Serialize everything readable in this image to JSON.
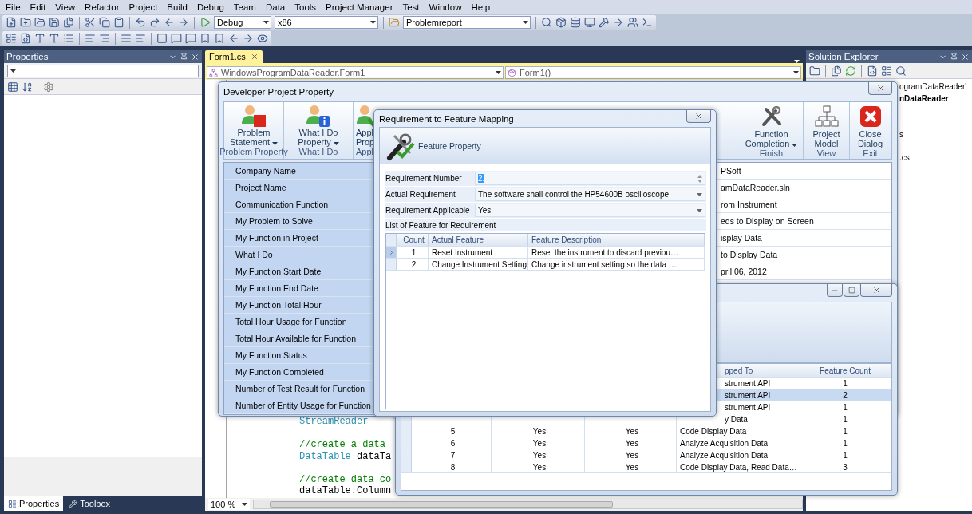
{
  "menu": [
    "File",
    "Edit",
    "View",
    "Refactor",
    "Project",
    "Build",
    "Debug",
    "Team",
    "Data",
    "Tools",
    "Project Manager",
    "Test",
    "Window",
    "Help"
  ],
  "toolbar": {
    "configuration": "Debug",
    "platform": "x86",
    "find_target": "Problemreport"
  },
  "properties_panel": {
    "title": "Properties",
    "tabs": [
      {
        "label": "Properties",
        "selected": true
      },
      {
        "label": "Toolbox",
        "selected": false
      }
    ]
  },
  "editor": {
    "tabs": [
      {
        "label": "Form1.cs",
        "selected": true
      }
    ],
    "class_selector": "WindowsProgramDataReader.Form1",
    "member_selector": "Form1()",
    "zoom": "100 %",
    "code_lines": [
      {
        "kind": "code",
        "tokens": [
          {
            "text": "StreamReader",
            "kind": "type"
          }
        ]
      },
      {
        "kind": "blank"
      },
      {
        "kind": "code",
        "tokens": [
          {
            "text": "//create a data",
            "kind": "comment"
          }
        ]
      },
      {
        "kind": "code",
        "tokens": [
          {
            "text": "DataTable",
            "kind": "type"
          },
          {
            "text": "dataTa",
            "kind": "code"
          }
        ]
      },
      {
        "kind": "blank"
      },
      {
        "kind": "code",
        "tokens": [
          {
            "text": "//create data co",
            "kind": "comment"
          }
        ]
      },
      {
        "kind": "code",
        "tokens": [
          {
            "text": "dataTable.Column",
            "kind": "code"
          }
        ]
      }
    ]
  },
  "solution_explorer": {
    "title": "Solution Explorer",
    "items": [
      {
        "label": "ogramDataReader'",
        "bold": false
      },
      {
        "label": "nDataReader",
        "bold": true
      },
      {
        "label": "s",
        "bold": false
      },
      {
        "label": ".cs",
        "bold": false
      }
    ]
  },
  "developer_window": {
    "title": "Developer Project Property",
    "ribbon_groups": [
      {
        "caption": "Problem Property",
        "button": {
          "label": "Problem Statement",
          "dropdown": true
        }
      },
      {
        "caption": "What I Do",
        "button": {
          "label": "What I Do Property",
          "dropdown": true
        }
      },
      {
        "caption": "Appl",
        "button": {
          "label": "Appl Prop",
          "dropdown": false
        }
      },
      {
        "caption": "Finish",
        "button": {
          "label": "Function Completion",
          "dropdown": true
        }
      },
      {
        "caption": "View",
        "button": {
          "label": "Project Model",
          "dropdown": false
        }
      },
      {
        "caption": "Exit",
        "button": {
          "label": "Close Dialog",
          "dropdown": false
        }
      }
    ],
    "properties": [
      {
        "label": "Company Name",
        "value": "PSoft"
      },
      {
        "label": "Project Name",
        "value": "amDataReader.sln"
      },
      {
        "label": "Communication Function",
        "value": "rom Instrument"
      },
      {
        "label": "My Problem to Solve",
        "value": "eds to Display on Screen"
      },
      {
        "label": "My Function in Project",
        "value": "isplay Data"
      },
      {
        "label": "What I Do",
        "value": "to Display Data"
      },
      {
        "label": "My Function Start Date",
        "value": "pril 06, 2012"
      },
      {
        "label": "My Function End Date"
      },
      {
        "label": "My Function Total Hour"
      },
      {
        "label": "Total Hour Usage for Function"
      },
      {
        "label": "Total Hour Available for Function"
      },
      {
        "label": "My Function Status"
      },
      {
        "label": "My Function Completed"
      },
      {
        "label": "Number of Test Result for Function"
      },
      {
        "label": "Number of Entity Usage for Function"
      }
    ]
  },
  "mapping_window": {
    "columns": [
      "pped To",
      "Feature Count"
    ],
    "rows": [
      {
        "column_4": "strument API",
        "column_5": "1",
        "selected": false
      },
      {
        "column_4": "strument API",
        "column_5": "2",
        "selected": true
      },
      {
        "column_4": "strument API",
        "column_5": "1",
        "selected": false
      },
      {
        "column_4": "y Data",
        "column_5": "1",
        "selected": false
      },
      {
        "column_1": "5",
        "column_2": "Yes",
        "column_3": "Yes",
        "column_4": "Code Display Data",
        "column_5": "1",
        "selected": false
      },
      {
        "column_1": "6",
        "column_2": "Yes",
        "column_3": "Yes",
        "column_4": "Analyze Acquisition Data",
        "column_5": "1",
        "selected": false
      },
      {
        "column_1": "7",
        "column_2": "Yes",
        "column_3": "Yes",
        "column_4": "Analyze Acquisition Data",
        "column_5": "1",
        "selected": false
      },
      {
        "column_1": "8",
        "column_2": "Yes",
        "column_3": "Yes",
        "column_4": "Code Display Data, Read Data…",
        "column_5": "3",
        "selected": false
      }
    ]
  },
  "feature_dialog": {
    "title": "Requirement to Feature Mapping",
    "header": "Feature Property",
    "fields": [
      {
        "label": "Requirement Number",
        "value": "2.",
        "kind": "spin",
        "value_highlighted": true
      },
      {
        "label": "Actual Requirement",
        "value": "The software shall control the HP54600B oscilloscope",
        "kind": "combo",
        "value_highlighted": false
      },
      {
        "label": "Requirement Applicable",
        "value": "Yes",
        "kind": "combo",
        "value_highlighted": false
      }
    ],
    "list_title": "List of Feature for Requirement",
    "columns": [
      "Count",
      "Actual Feature",
      "Feature Description"
    ],
    "rows": [
      {
        "count": "1",
        "feature": "Reset Instrument",
        "description": "Reset the instrument to discard previou…",
        "current": true
      },
      {
        "count": "2",
        "feature": "Change Instrument Setting",
        "description": "Change instrument setting so the data …",
        "current": false
      }
    ]
  }
}
